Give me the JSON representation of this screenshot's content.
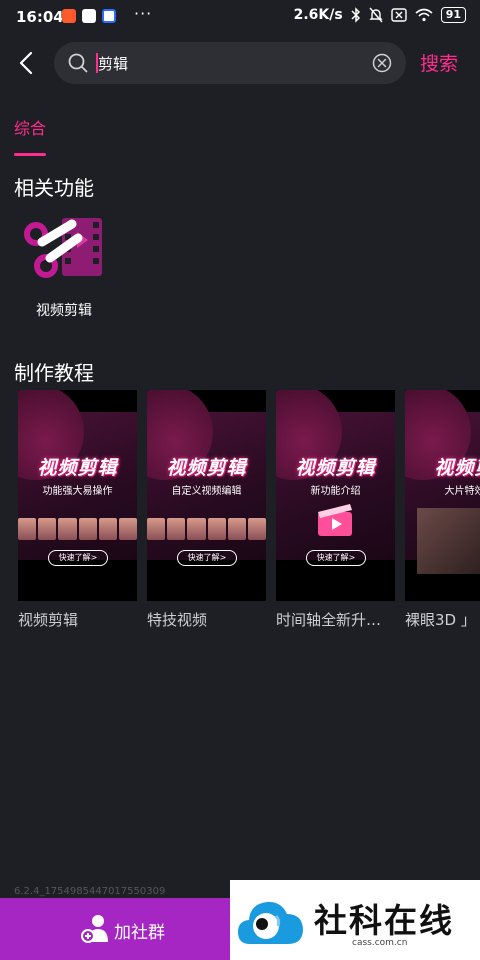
{
  "status_bar": {
    "time": "16:04",
    "dots": "···",
    "net_speed": "2.6K/s",
    "battery": "91"
  },
  "search": {
    "query": "剪辑",
    "submit_label": "搜索"
  },
  "tabs": [
    {
      "label": "综合",
      "active": true
    }
  ],
  "related_functions": {
    "title": "相关功能",
    "items": [
      {
        "label": "视频剪辑",
        "icon": "video-edit-icon"
      }
    ]
  },
  "tutorials": {
    "title": "制作教程",
    "cards": [
      {
        "title": "视频剪辑",
        "thumb_title": "视频剪辑",
        "thumb_subtitle": "功能强大易操作",
        "thumb_button": "快速了解>"
      },
      {
        "title": "特技视频",
        "thumb_title": "视频剪辑",
        "thumb_subtitle": "自定义视频编辑",
        "thumb_button": "快速了解>"
      },
      {
        "title": "时间轴全新升…",
        "thumb_title": "视频剪辑",
        "thumb_subtitle": "新功能介绍",
        "thumb_button": "快速了解>"
      },
      {
        "title": "裸眼3D 」",
        "thumb_title": "视频剪",
        "thumb_subtitle": "大片特效",
        "thumb_button": ""
      }
    ]
  },
  "version_text": "6.2.4_1754985447017550309",
  "bottom": {
    "join_group_label": "加社群",
    "logo_text": "社科在线",
    "logo_domain": "cass.com.cn"
  },
  "colors": {
    "accent": "#ff2d8f",
    "background": "#1e1f24",
    "bottom_left": "#a626c4"
  }
}
